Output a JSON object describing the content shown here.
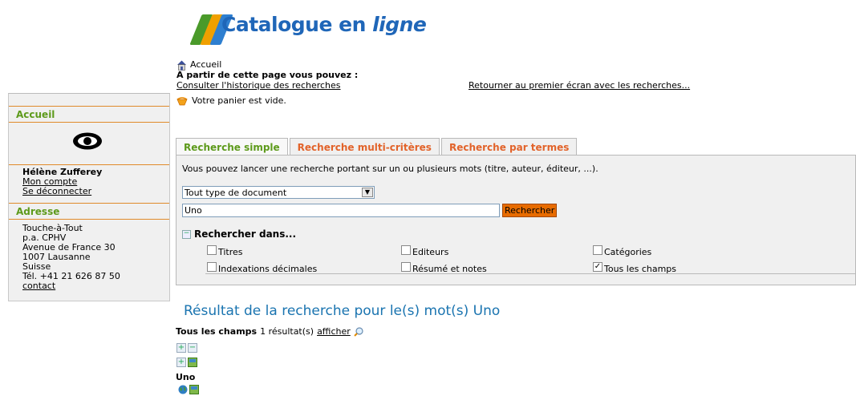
{
  "logo": {
    "text_main": "Catalogue en ",
    "text_italic": "ligne"
  },
  "sidebar": {
    "accueil_title": "Accueil",
    "user_name": "Hélène Zufferey",
    "mon_compte": "Mon compte",
    "deconnecter": "Se déconnecter",
    "adresse_title": "Adresse",
    "address_lines": [
      "Touche-à-Tout",
      "p.a. CPHV",
      "Avenue de France 30",
      "1007 Lausanne",
      "Suisse",
      "Tél. +41 21 626 87 50"
    ],
    "contact": "contact"
  },
  "nav": {
    "home": "Accueil",
    "intro": "A partir de cette page vous pouvez :",
    "history_link": "Consulter l'historique des recherches",
    "first_screen_link": "Retourner au premier écran avec les recherches...",
    "cart_status": "Votre panier est vide."
  },
  "tabs": [
    {
      "label": "Recherche simple",
      "active": true
    },
    {
      "label": "Recherche multi-critères",
      "active": false
    },
    {
      "label": "Recherche par termes",
      "active": false
    }
  ],
  "search": {
    "description": "Vous pouvez lancer une recherche portant sur un ou plusieurs mots (titre, auteur, éditeur, ...).",
    "doctype_selected": "Tout type de document",
    "query_value": "Uno",
    "button_label": "Rechercher",
    "search_in_label": "Rechercher dans...",
    "fields": [
      {
        "label": "Titres",
        "checked": false
      },
      {
        "label": "Editeurs",
        "checked": false
      },
      {
        "label": "Catégories",
        "checked": false
      },
      {
        "label": "Indexations décimales",
        "checked": false
      },
      {
        "label": "Résumé et notes",
        "checked": false
      },
      {
        "label": "Tous les champs",
        "checked": true
      }
    ]
  },
  "results": {
    "title": "Résultat de la recherche pour le(s) mot(s) Uno",
    "field_name": "Tous les champs",
    "count_text": "1 résultat(s)",
    "show_link": "afficher",
    "record_title": "Uno"
  },
  "colors": {
    "accent_green": "#5d9a1b",
    "accent_orange": "#e2632a",
    "link_blue": "#1a74b0",
    "button_orange": "#e76b00"
  }
}
